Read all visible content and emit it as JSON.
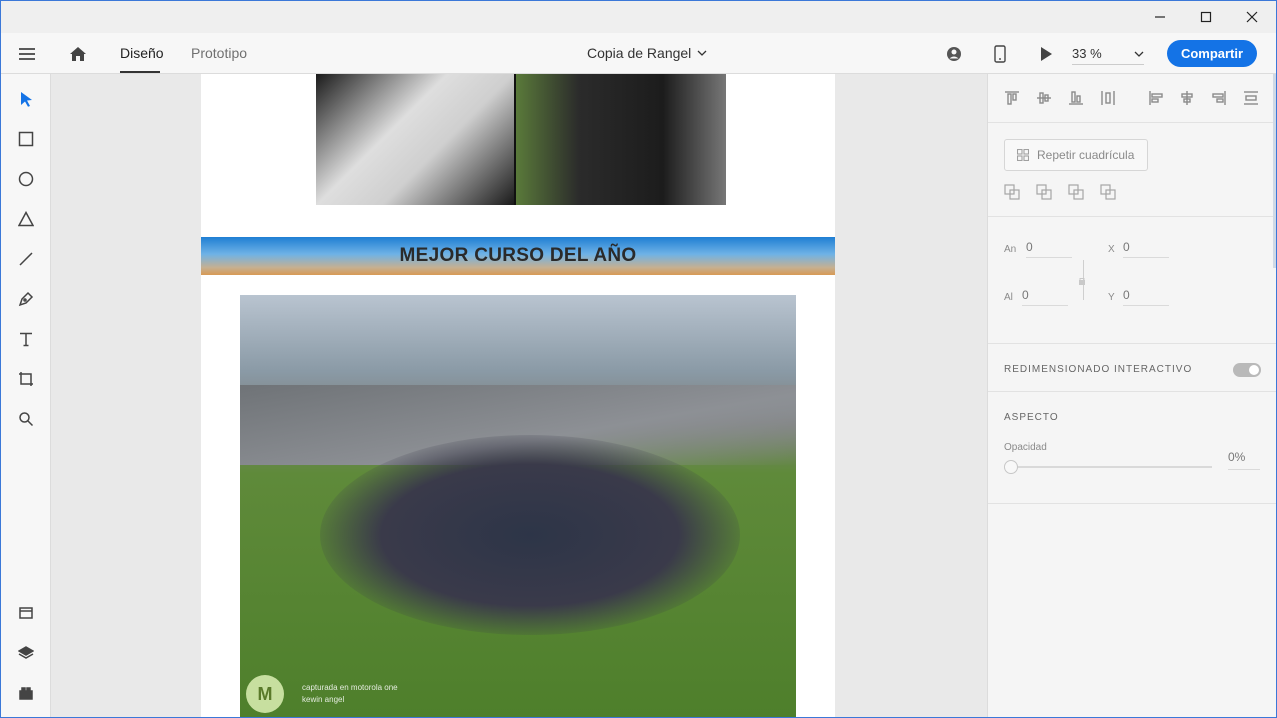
{
  "window": {
    "minimize_icon": "minimize-icon",
    "maximize_icon": "maximize-icon",
    "close_icon": "close-icon"
  },
  "appbar": {
    "tabs": [
      {
        "label": "Diseño",
        "active": true
      },
      {
        "label": "Prototipo",
        "active": false
      }
    ],
    "document_name": "Copia de Rangel",
    "zoom": "33 %",
    "share_label": "Compartir",
    "accent_color": "#1473e6"
  },
  "artboard": {
    "banner_title": "MEJOR CURSO DEL AÑO",
    "watermark_line1": "capturada en motorola one",
    "watermark_line2": "kewin angel"
  },
  "properties": {
    "repeat_grid_label": "Repetir cuadrícula",
    "width_label": "An",
    "width_value": "0",
    "height_label": "Al",
    "height_value": "0",
    "x_label": "X",
    "x_value": "0",
    "y_label": "Y",
    "y_value": "0",
    "responsive_resize_label": "REDIMENSIONADO INTERACTIVO",
    "appearance_label": "ASPECTO",
    "opacity_label": "Opacidad",
    "opacity_value": "0%",
    "opacity_level": 0
  }
}
